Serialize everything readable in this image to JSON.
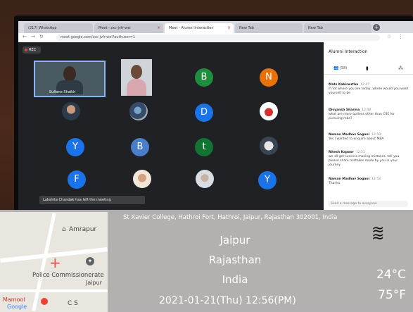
{
  "browser": {
    "tabs": [
      {
        "label": "(217) WhatsApp"
      },
      {
        "label": "Meet - zxc-jvfr-wei"
      },
      {
        "label": "Meet - Alumni Interaction"
      },
      {
        "label": "New Tab"
      },
      {
        "label": "New Tab"
      }
    ],
    "url": "meet.google.com/zxc-jvfr-wei?authuser=1"
  },
  "meet": {
    "rec_label": "REC",
    "self_name": "Sufiane Shaikh",
    "avatars": [
      "B",
      "N",
      "D",
      "Y",
      "B",
      "t",
      "F",
      "Y"
    ],
    "avatar_colors": {
      "green": "#1e8e3e",
      "orange": "#e8710a",
      "blue": "#1a73e8",
      "teal": "#137333"
    },
    "toast": "Lakshita Chandak has left the meeting"
  },
  "panel": {
    "title": "Alumni Interaction",
    "people_count": "(58)",
    "messages": [
      {
        "sender": "Mats Kabirwrtha",
        "time": "12:47",
        "text": "if not where you are today, where would you want yourself to be"
      },
      {
        "sender": "Divyansh Sharma",
        "time": "12:48",
        "text": "what are more options other than CSE for pursuing mba?"
      },
      {
        "sender": "Naman Madhav Sogani",
        "time": "12:50",
        "text": "Yes I wanted to enquire about MBA"
      },
      {
        "sender": "Ritesh Kapoor",
        "time": "12:51",
        "text": "we all get success making mistakes. tell you please share mistakes made by you in your journey"
      },
      {
        "sender": "Naman Madhav Sogani",
        "time": "12:53",
        "text": "Thanks"
      }
    ],
    "input_placeholder": "Send a message to everyone"
  },
  "overlay": {
    "address": "St Xavier College, Hathroi Fort, Hathroi, Jaipur, Rajasthan 302001, India",
    "city": "Jaipur",
    "state": "Rajasthan",
    "country": "India",
    "datetime": "2021-01-21(Thu)   12:56(PM)",
    "temp_c": "24°C",
    "temp_f": "75°F",
    "map_labels": {
      "place1": "Amrapur",
      "place2": "Police Commissionerate",
      "place3": "Jaipur",
      "place4": "C S",
      "place5": "Mamool",
      "google": "Google"
    }
  }
}
